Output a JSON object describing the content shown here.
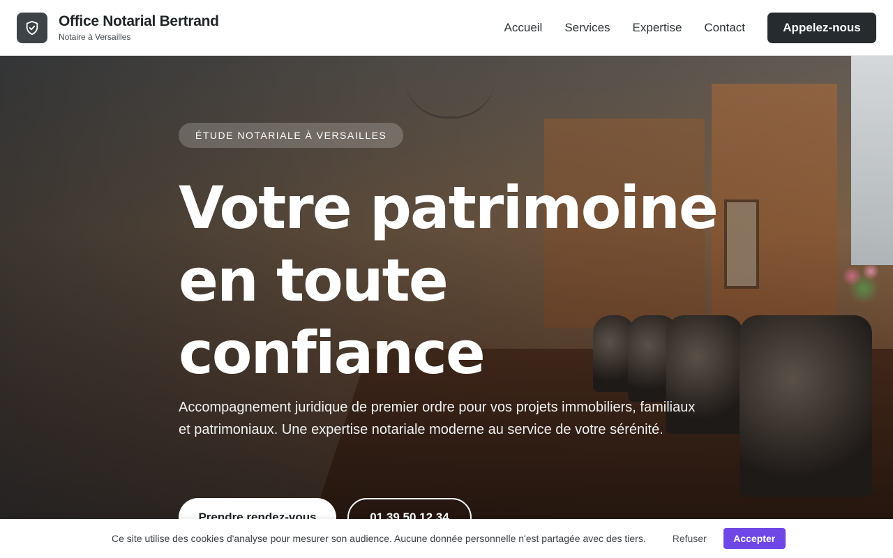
{
  "header": {
    "logo_icon": "shield-check-icon",
    "brand_name": "Office Notarial Bertrand",
    "brand_subtitle": "Notaire à Versailles",
    "nav": [
      {
        "label": "Accueil"
      },
      {
        "label": "Services"
      },
      {
        "label": "Expertise"
      },
      {
        "label": "Contact"
      }
    ],
    "call_button": "Appelez-nous"
  },
  "hero": {
    "badge": "ÉTUDE NOTARIALE À VERSAILLES",
    "headline_line1": "Votre patrimoine",
    "headline_line2": "en toute",
    "headline_line3": "confiance",
    "lead": "Accompagnement juridique de premier ordre pour vos projets immobiliers, familiaux et patrimoniaux. Une expertise notariale moderne au service de votre sérénité.",
    "primary_cta": "Prendre rendez-vous",
    "secondary_cta": "01 39 50 12 34"
  },
  "cookie_banner": {
    "text": "Ce site utilise des cookies d'analyse pour mesurer son audience. Aucune donnée personnelle n'est partagée avec des tiers.",
    "refuse_label": "Refuser",
    "accept_label": "Accepter"
  },
  "colors": {
    "primary_dark": "#262b2f",
    "accent_purple": "#6f47e6"
  }
}
